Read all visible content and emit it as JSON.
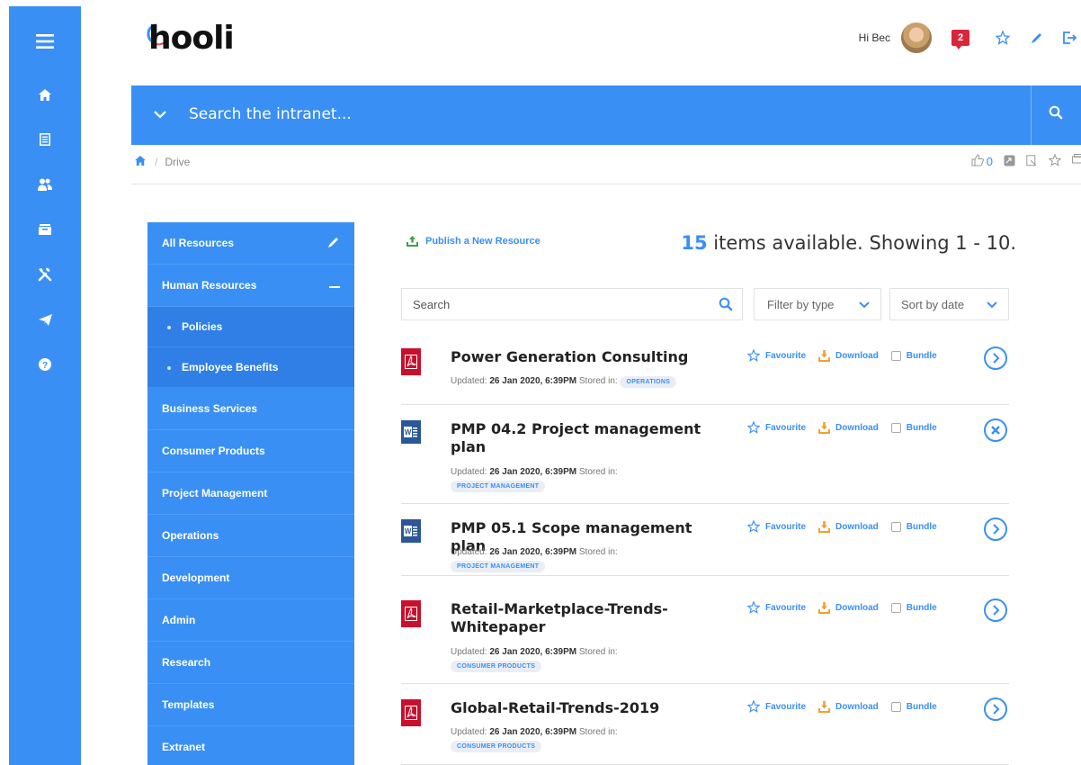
{
  "app": {
    "logo": "hooli",
    "greeting": "Hi Bec",
    "notification_count": "2"
  },
  "search": {
    "placeholder": "Search the intranet..."
  },
  "breadcrumb": {
    "current": "Drive"
  },
  "page_actions": {
    "like_count": "0"
  },
  "rail": {
    "items": [
      "menu-icon",
      "home-icon",
      "document-icon",
      "people-icon",
      "inbox-icon",
      "tools-icon",
      "send-icon",
      "help-icon"
    ]
  },
  "sidebar": {
    "items": [
      {
        "label": "All Resources"
      },
      {
        "label": "Human Resources"
      },
      {
        "label": "Policies"
      },
      {
        "label": "Employee Benefits"
      },
      {
        "label": "Business Services"
      },
      {
        "label": "Consumer Products"
      },
      {
        "label": "Project Management"
      },
      {
        "label": "Operations"
      },
      {
        "label": "Development"
      },
      {
        "label": "Admin"
      },
      {
        "label": "Research"
      },
      {
        "label": "Templates"
      },
      {
        "label": "Extranet"
      }
    ]
  },
  "main": {
    "publish_label": "Publish a New Resource",
    "items_count": "15",
    "items_text": "items available. Showing 1 - 10.",
    "search_placeholder": "Search",
    "filter_label": "Filter by type",
    "sort_label": "Sort by date",
    "favourite_label": "Favourite",
    "download_label": "Download",
    "bundle_label": "Bundle",
    "updated_label": "Updated:",
    "stored_label": "Stored in:",
    "resources": [
      {
        "title": "Power Generation Consulting",
        "type": "pdf",
        "updated": "26 Jan 2020, 6:39PM",
        "tag": "OPERATIONS",
        "state": "open"
      },
      {
        "title": "PMP 04.2 Project management plan",
        "type": "word",
        "updated": "26 Jan 2020, 6:39PM",
        "tag": "PROJECT MANAGEMENT",
        "state": "close"
      },
      {
        "title": "PMP 05.1 Scope management plan",
        "type": "word",
        "updated": "26 Jan 2020, 6:39PM",
        "tag": "PROJECT MANAGEMENT",
        "state": "open"
      },
      {
        "title": "Retail-Marketplace-Trends-Whitepaper",
        "type": "pdf",
        "updated": "26 Jan 2020, 6:39PM",
        "tag": "CONSUMER PRODUCTS",
        "state": "open"
      },
      {
        "title": "Global-Retail-Trends-2019",
        "type": "pdf",
        "updated": "26 Jan 2020, 6:39PM",
        "tag": "CONSUMER PRODUCTS",
        "state": "open"
      }
    ]
  },
  "colors": {
    "accent": "#3a8ff5",
    "pdf": "#c8102e",
    "word": "#2b5797",
    "download": "#f0a030"
  }
}
